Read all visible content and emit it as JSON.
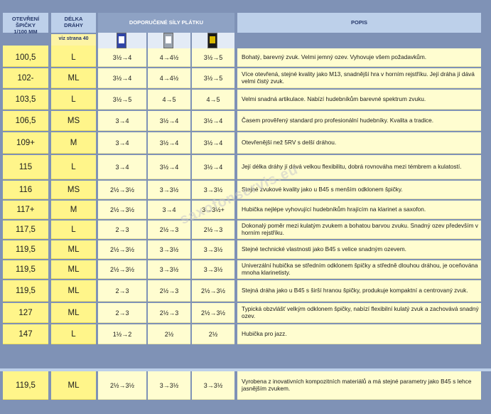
{
  "header": {
    "tip_opening": "OTEVŘENÍ ŠPIČKY\n1/100 MM",
    "length": "DÉLKA\nDRÁHY",
    "length_sub": "viz strana 40",
    "reeds": "DOPORUČENÉ SÍLY PLÁTKU",
    "description": "POPIS"
  },
  "reed_icons": [
    "blue-reed-box-icon",
    "grey-reed-box-icon",
    "black-reed-box-icon"
  ],
  "rows": [
    {
      "tip": "100,5",
      "len": "L",
      "r1": "3½→4",
      "r2": "4→4½",
      "r3": "3½→5",
      "desc": "Bohatý, barevný zvuk. Velmi jemný ozev. Vyhovuje všem požadavkům."
    },
    {
      "tip": "102-",
      "len": "ML",
      "r1": "3½→4",
      "r2": "4→4½",
      "r3": "3½→5",
      "desc": "Více otevřená, stejné kvality jako M13, snadnější hra v horním rejstříku. Její dráha jí dává velmi čistý zvuk."
    },
    {
      "tip": "103,5",
      "len": "L",
      "r1": "3½→5",
      "r2": "4→5",
      "r3": "4→5",
      "desc": "Velmi snadná artikulace. Nabízí hudebníkům barevné spektrum zvuku."
    },
    {
      "tip": "106,5",
      "len": "MS",
      "r1": "3→4",
      "r2": "3½→4",
      "r3": "3½→4",
      "desc": "Časem prověřený standard pro profesionální hudebníky. Kvalita a tradice."
    },
    {
      "tip": "109+",
      "len": "M",
      "r1": "3→4",
      "r2": "3½→4",
      "r3": "3½→4",
      "desc": "Otevřenější než 5RV s delší dráhou."
    },
    {
      "tip": "115",
      "len": "L",
      "r1": "3→4",
      "r2": "3½→4",
      "r3": "3½→4",
      "desc": "Její délka dráhy jí dává velkou flexibilitu, dobrá rovnováha mezi témbrem a kulatostí."
    },
    {
      "tip": "116",
      "len": "MS",
      "r1": "2½→3½",
      "r2": "3→3½",
      "r3": "3→3½",
      "desc": "Stejné zvukové kvality jako u B45 s menším odklonem špičky."
    },
    {
      "tip": "117+",
      "len": "M",
      "r1": "2½→3½",
      "r2": "3→4",
      "r3": "3→3½+",
      "desc": "Hubička nejlépe vyhovující hudebníkům hrajícím na klarinet a saxofon."
    },
    {
      "tip": "117,5",
      "len": "L",
      "r1": "2→3",
      "r2": "2½→3",
      "r3": "2½→3",
      "desc": "Dokonalý poměr mezi kulatým zvukem a bohatou barvou zvuku. Snadný ozev především v horním rejstříku."
    },
    {
      "tip": "119,5",
      "len": "ML",
      "r1": "2½→3½",
      "r2": "3→3½",
      "r3": "3→3½",
      "desc": "Stejné technické vlastnosti jako B45 s velice snadným ozevem."
    },
    {
      "tip": "119,5",
      "len": "ML",
      "r1": "2½→3½",
      "r2": "3→3½",
      "r3": "3→3½",
      "desc": "Univerzální hubička se středním odklonem špičky a středně dlouhou dráhou, je oceňována mnoha klarinetisty."
    },
    {
      "tip": "119,5",
      "len": "ML",
      "r1": "2→3",
      "r2": "2½→3",
      "r3": "2½→3½",
      "desc": "Stejná dráha jako u B45 s širší hranou špičky, produkuje kompaktní a centrovaný zvuk."
    },
    {
      "tip": "127",
      "len": "ML",
      "r1": "2→3",
      "r2": "2½→3",
      "r3": "2½→3½",
      "desc": "Typická obzvlášť velkým odklonem špičky, nabízí flexibilní kulatý zvuk a zachovává snadný ozev."
    },
    {
      "tip": "147",
      "len": "L",
      "r1": "1½→2",
      "r2": "2½",
      "r3": "2½",
      "desc": "Hubička pro jazz."
    }
  ],
  "extra_row": {
    "tip": "119,5",
    "len": "ML",
    "r1": "2½→3½",
    "r2": "3→3½",
    "r3": "3→3½",
    "desc": "Vyrobena z inovativních kompozitních materiálů a má stejné parametry jako B45 s lehce jasnějším zvukem."
  },
  "watermark": "saxofonservis.eu",
  "colors": {
    "background": "#7f92b6",
    "header": "#bdd0ea",
    "yellow": "#fff58a",
    "cream": "#fffdd0"
  }
}
